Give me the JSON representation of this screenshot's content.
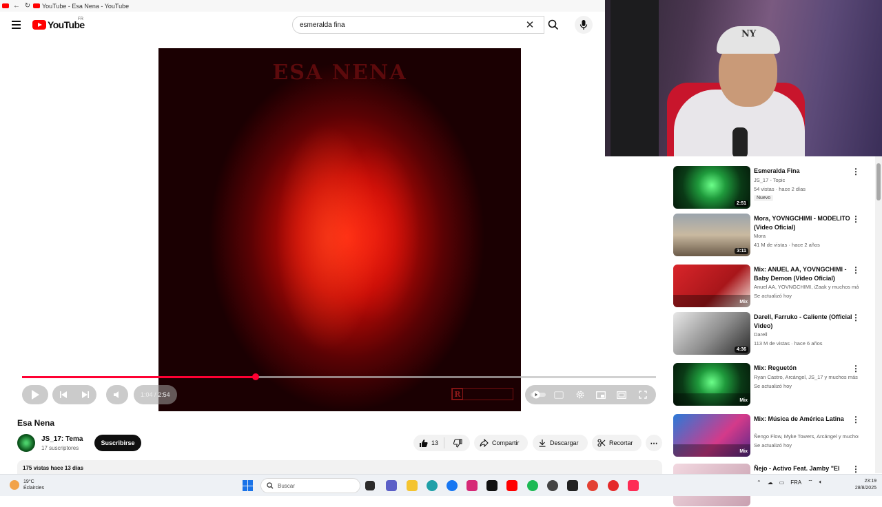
{
  "browser": {
    "tab_title": "YouTube - Esa Nena - YouTube"
  },
  "header": {
    "logo_text": "YouTube",
    "country_code": "FR",
    "search_value": "esmeralda fina"
  },
  "player": {
    "art_title": "ESA NENA",
    "progress_fraction": 0.369,
    "current_time": "1:04",
    "time_separator": "/",
    "duration": "2:54"
  },
  "video": {
    "title": "Esa Nena",
    "channel_name": "JS_17: Tema",
    "subscribers": "17 suscriptores",
    "subscribe_label": "Suscribirse",
    "like_count": "13",
    "share_label": "Compartir",
    "download_label": "Descargar",
    "clip_label": "Recortar",
    "stats": "175 vistas  hace 13 días"
  },
  "recommendations": [
    {
      "title": "Esmeralda Fina",
      "channel": "JS_17 - Topic",
      "meta": "54 vistas · hace 2 días",
      "badge": "Nuevo",
      "duration": "2:51",
      "mix": "",
      "thumb": "emerald"
    },
    {
      "title": "Mora, YOVNGCHIMI - MODELITO (Video Oficial)",
      "channel": "Mora",
      "meta": "41 M de vistas · hace 2 años",
      "badge": "",
      "duration": "3:11",
      "mix": "",
      "thumb": "street"
    },
    {
      "title": "Mix: ANUEL AA, YOVNGCHIMI - Baby Demon (Video Oficial)",
      "channel": "Anuel AA, YOVNGCHIMI, iZaak y muchos más",
      "meta": "Se actualizó hoy",
      "badge": "",
      "duration": "",
      "mix": "Mix",
      "thumb": "red"
    },
    {
      "title": "Darell, Farruko - Caliente (Official Video)",
      "channel": "Darell",
      "meta": "113 M de vistas · hace 6 años",
      "badge": "",
      "duration": "4:36",
      "mix": "",
      "thumb": "bw"
    },
    {
      "title": "Mix: Reguetón",
      "channel": "Ryan Castro, Arcángel, JS_17 y muchos más",
      "meta": "Se actualizó hoy",
      "badge": "",
      "duration": "",
      "mix": "Mix",
      "thumb": "emerald"
    },
    {
      "title": "Mix: Música de América Latina",
      "channel": "Ñengo Flow, Myke Towers, Arcángel y muchos más",
      "meta": "Se actualizó hoy",
      "badge": "",
      "duration": "",
      "mix": "Mix",
      "thumb": "blue"
    },
    {
      "title": "Ñejo - Activo Feat. Jamby \"El",
      "channel": "",
      "meta": "",
      "badge": "",
      "duration": "",
      "mix": "",
      "thumb": "pink"
    }
  ],
  "taskbar": {
    "weather_temp": "19°C",
    "weather_desc": "Éclaircies",
    "search_placeholder": "Buscar",
    "lang": "FRA",
    "time": "23:19",
    "date": "28/8/2025"
  },
  "colors": {
    "accent": "#ff0033",
    "youtube_red": "#ff0000"
  }
}
